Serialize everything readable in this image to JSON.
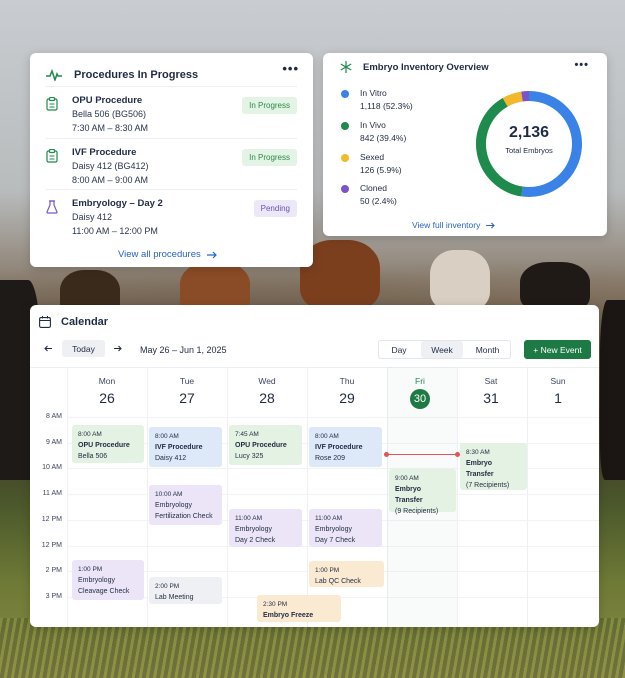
{
  "procedures": {
    "title": "Procedures In Progress",
    "menu": "•••",
    "items": [
      {
        "name": "OPU Procedure",
        "animal": "Bella 506 (BG506)",
        "time": "7:30 AM – 8:30 AM",
        "status": "In Progress",
        "status_color": "green",
        "icon": "clipboard-icon"
      },
      {
        "name": "IVF Procedure",
        "animal": "Daisy 412 (BG412)",
        "time": "8:00 AM – 9:00 AM",
        "status": "In Progress",
        "status_color": "green",
        "icon": "clipboard-icon"
      },
      {
        "name": "Embryology – Day 2",
        "animal": "Daisy 412",
        "time": "11:00 AM – 12:00 PM",
        "status": "Pending",
        "status_color": "purple",
        "icon": "flask-icon"
      }
    ],
    "view_all": "View all procedures"
  },
  "inventory": {
    "title": "Embryo Inventory Overview",
    "menu": "•••",
    "total": "2,136",
    "total_label": "Total Embryos",
    "view_full": "View full inventory",
    "chart_data": {
      "type": "pie",
      "categories": [
        "In Vitro",
        "In Vivo",
        "Sexed",
        "Cloned"
      ],
      "values": [
        1118,
        842,
        126,
        50
      ],
      "percents": [
        "52.3%",
        "39.4%",
        "5.9%",
        "2.4%"
      ],
      "value_labels": [
        "1,118 (52.3%)",
        "842 (39.4%)",
        "126 (5.9%)",
        "50 (2.4%)"
      ],
      "colors": [
        "#3b82e6",
        "#1e8a4c",
        "#f2b92b",
        "#7a55c9"
      ]
    }
  },
  "calendar": {
    "title": "Calendar",
    "today": "Today",
    "range": "May 26 – Jun 1, 2025",
    "views": [
      "Day",
      "Week",
      "Month"
    ],
    "active_view": "Week",
    "new_event": "+ New Event",
    "days": [
      {
        "name": "Mon",
        "date": "26"
      },
      {
        "name": "Tue",
        "date": "27"
      },
      {
        "name": "Wed",
        "date": "28"
      },
      {
        "name": "Thu",
        "date": "29"
      },
      {
        "name": "Fri",
        "date": "30"
      },
      {
        "name": "Sat",
        "date": "31"
      },
      {
        "name": "Sun",
        "date": "1"
      }
    ],
    "today_index": 4,
    "times": [
      "8 AM",
      "9 AM",
      "10 AM",
      "11 AM",
      "12 PM",
      "12 PM",
      "2 PM",
      "3 PM"
    ],
    "events": [
      {
        "time": "8:00 AM",
        "title": "OPU Procedure",
        "sub": "Bella 506",
        "color": "green"
      },
      {
        "time": "8:00 AM",
        "title": "IVF Procedure",
        "sub": "Daisy 412",
        "color": "blue"
      },
      {
        "time": "7:45 AM",
        "title": "OPU Procedure",
        "sub": "Lucy 325",
        "color": "green"
      },
      {
        "time": "8:00 AM",
        "title": "IVF Procedure",
        "sub": "Rose 209",
        "color": "blue"
      },
      {
        "time": "8:30 AM",
        "title": "Embryo Transfer",
        "sub": "(7 Recipients)",
        "color": "green"
      },
      {
        "time": "9:00 AM",
        "title": "Embryo Transfer",
        "sub": "(9 Recipients)",
        "color": "green"
      },
      {
        "time": "10:00 AM",
        "title": "Embryology",
        "sub": "Fertilization Check",
        "color": "purple"
      },
      {
        "time": "11:00 AM",
        "title": "Embryology",
        "sub": "Day 2 Check",
        "color": "purple"
      },
      {
        "time": "11:00 AM",
        "title": "Embryology",
        "sub": "Day 7 Check",
        "color": "purple"
      },
      {
        "time": "1:00 PM",
        "title": "Embryology",
        "sub": "Cleavage Check",
        "color": "purple"
      },
      {
        "time": "2:00 PM",
        "title": "Lab Meeting",
        "sub": "",
        "color": "gray"
      },
      {
        "time": "1:00 PM",
        "title": "Lab QC Check",
        "sub": "",
        "color": "orange"
      },
      {
        "time": "2:30 PM",
        "title": "Embryo Freeze",
        "sub": "",
        "color": "orange"
      }
    ]
  }
}
